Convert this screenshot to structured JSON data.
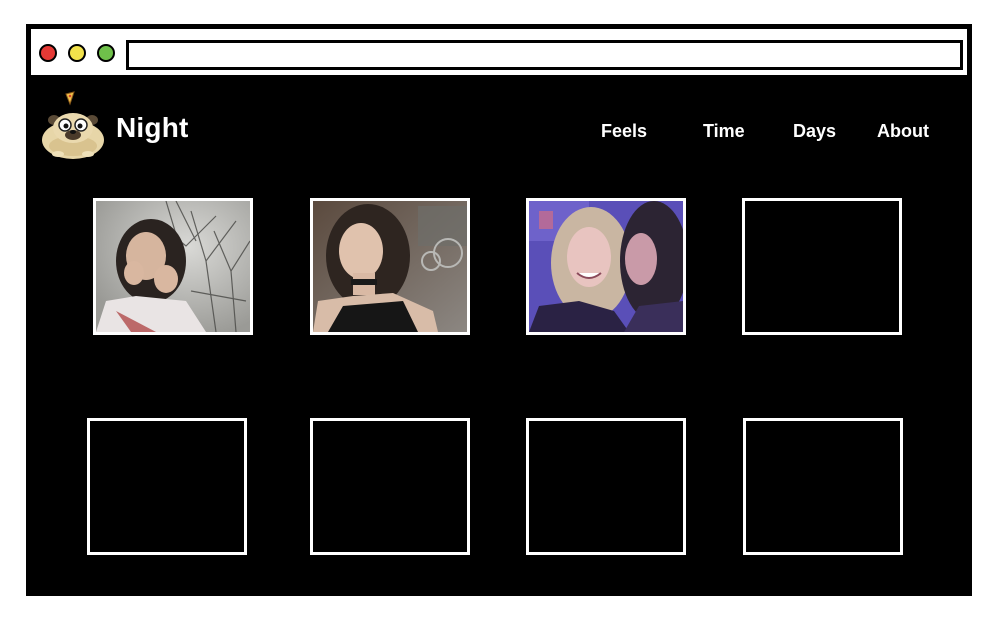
{
  "colors": {
    "window_bg": "#000000",
    "chrome_bg": "#ffffff",
    "close_light": "#e53935",
    "minimize_light": "#f2e24b",
    "maximize_light": "#6fc04a",
    "text": "#ffffff",
    "tile_border": "#ffffff"
  },
  "browser": {
    "address_value": ""
  },
  "site": {
    "title": "Night",
    "logo_icon": "pug-with-pizza-icon"
  },
  "nav": {
    "items": [
      {
        "label": "Feels"
      },
      {
        "label": "Time"
      },
      {
        "label": "Days"
      },
      {
        "label": "About"
      }
    ]
  },
  "gallery": {
    "tiles": [
      {
        "state": "photo",
        "scene": "girl-winter-trees"
      },
      {
        "state": "photo",
        "scene": "girl-city-night"
      },
      {
        "state": "photo",
        "scene": "two-girls-purple-light"
      },
      {
        "state": "empty"
      },
      {
        "state": "empty"
      },
      {
        "state": "empty"
      },
      {
        "state": "empty"
      },
      {
        "state": "empty"
      }
    ]
  }
}
